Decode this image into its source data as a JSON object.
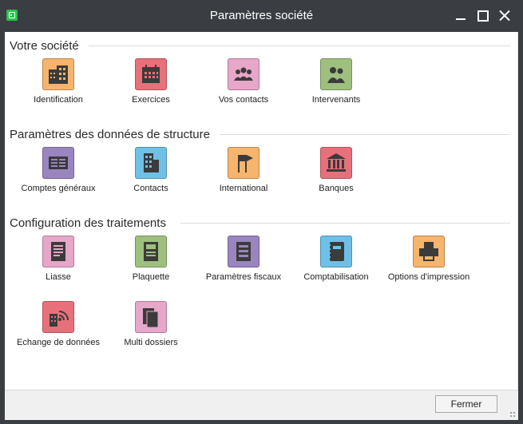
{
  "window": {
    "title": "Paramètres société"
  },
  "sections": [
    {
      "title": "Votre société",
      "items": [
        {
          "label": "Identification",
          "icon": "building-icon",
          "color": "#f6b46c"
        },
        {
          "label": "Exercices",
          "icon": "calendar-icon",
          "color": "#e8707a"
        },
        {
          "label": "Vos contacts",
          "icon": "people-icon",
          "color": "#e7a7c8"
        },
        {
          "label": "Intervenants",
          "icon": "person-group-icon",
          "color": "#9fbf7e"
        }
      ]
    },
    {
      "title": "Paramètres des données de structure",
      "items": [
        {
          "label": "Comptes généraux",
          "icon": "ledger-icon",
          "color": "#9a86bf"
        },
        {
          "label": "Contacts",
          "icon": "office-building-icon",
          "color": "#6ec0e7"
        },
        {
          "label": "International",
          "icon": "flags-icon",
          "color": "#f6b46c"
        },
        {
          "label": "Banques",
          "icon": "bank-icon",
          "color": "#e8707a"
        }
      ]
    },
    {
      "title": "Configuration des traitements",
      "items": [
        {
          "label": "Liasse",
          "icon": "document-stack-icon",
          "color": "#e7a7c8"
        },
        {
          "label": "Plaquette",
          "icon": "booklet-icon",
          "color": "#9fbf7e"
        },
        {
          "label": "Paramètres fiscaux",
          "icon": "tax-form-icon",
          "color": "#9a86bf"
        },
        {
          "label": "Comptabilisation",
          "icon": "accounting-book-icon",
          "color": "#6ec0e7"
        },
        {
          "label": "Options d'impression",
          "icon": "printer-icon",
          "color": "#f6b46c"
        },
        {
          "label": "Echange de données",
          "icon": "data-exchange-icon",
          "color": "#e8707a"
        },
        {
          "label": "Multi dossiers",
          "icon": "multi-files-icon",
          "color": "#e7a7c8"
        }
      ]
    }
  ],
  "footer": {
    "close_label": "Fermer"
  }
}
